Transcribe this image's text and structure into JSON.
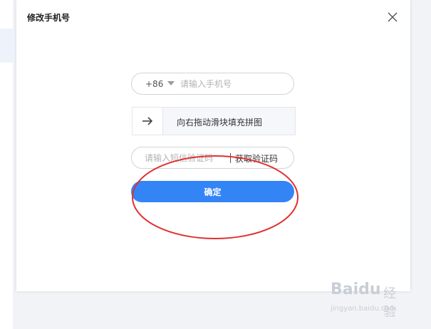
{
  "modal": {
    "title": "修改手机号",
    "close_icon": "close-icon"
  },
  "phone": {
    "country_code": "+86",
    "placeholder": "请输入手机号",
    "value": ""
  },
  "slider": {
    "label": "向右拖动滑块填充拼图",
    "handle_icon": "arrow-right-icon"
  },
  "sms": {
    "placeholder": "请输入短信验证码",
    "value": "",
    "get_code_label": "获取验证码"
  },
  "confirm": {
    "label": "确定"
  },
  "watermark": {
    "brand": "Baidu",
    "sub": "经验",
    "url": "jingyan.baidu.com"
  },
  "colors": {
    "primary": "#3385f6",
    "annotation": "#e03030",
    "border": "#cfd3da"
  }
}
